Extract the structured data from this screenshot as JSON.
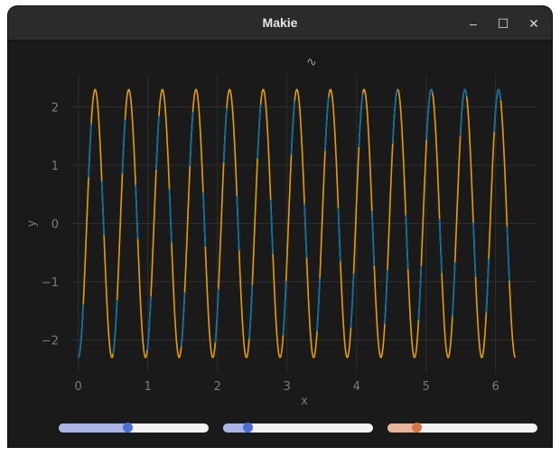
{
  "window": {
    "title": "Makie",
    "controls": {
      "minimize": "–",
      "maximize": "☐",
      "close": "✕"
    }
  },
  "chart_data": {
    "type": "line",
    "title": "∿",
    "xlabel": "x",
    "ylabel": "y",
    "xlim": [
      -0.1,
      6.6
    ],
    "ylim": [
      -2.55,
      2.55
    ],
    "grid": true,
    "xticks": [
      0,
      1,
      2,
      3,
      4,
      5,
      6
    ],
    "yticks": [
      2,
      1,
      0,
      -1,
      -2
    ],
    "ytick_labels": [
      "2",
      "1",
      "0",
      "−1",
      "−2"
    ],
    "series": [
      {
        "color": "#e69f00",
        "amplitude": 2.3,
        "frequency": 13,
        "offset": 0,
        "xrange": [
          0,
          6.283
        ]
      },
      {
        "color": "#0072b2",
        "amplitude": 2.3,
        "frequency": 13,
        "offset": 0,
        "xrange": [
          0,
          6.283
        ]
      }
    ]
  },
  "sliders": [
    {
      "name": "slider-1",
      "value": 0.46,
      "fill_color": "#aab7e6",
      "knob_color": "#4a70d6"
    },
    {
      "name": "slider-2",
      "value": 0.16,
      "fill_color": "#aab7e6",
      "knob_color": "#4a70d6"
    },
    {
      "name": "slider-3",
      "value": 0.19,
      "fill_color": "#e8b49a",
      "knob_color": "#d9734a"
    }
  ]
}
